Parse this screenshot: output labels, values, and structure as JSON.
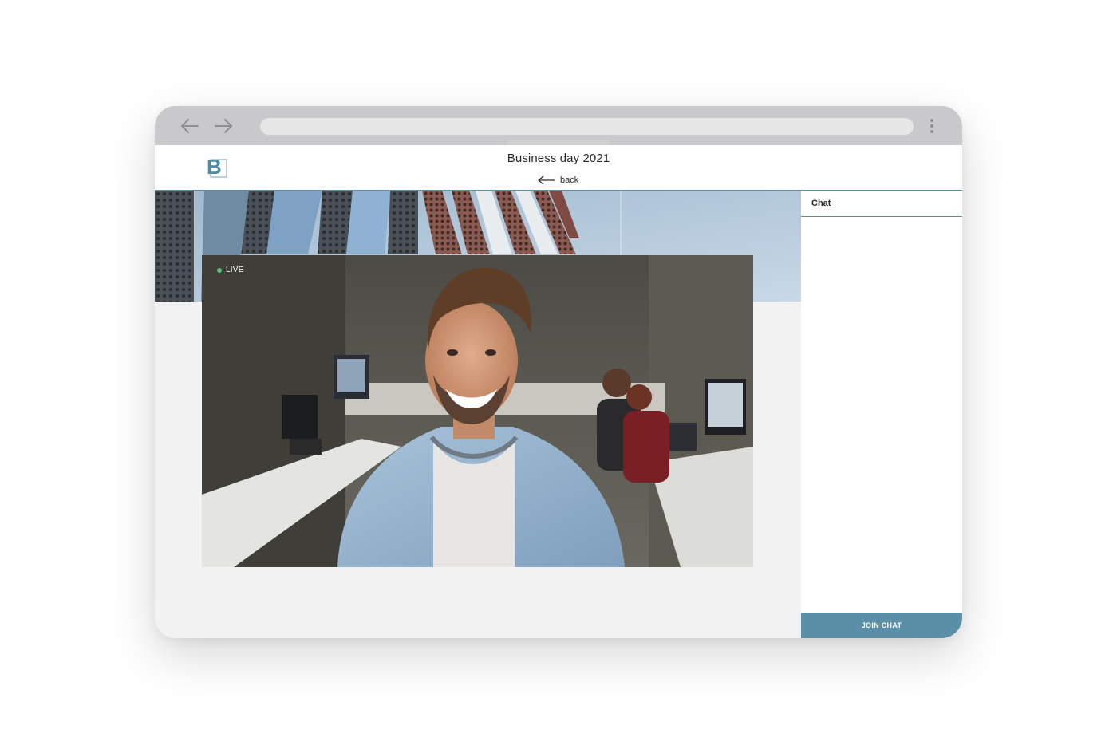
{
  "browser": {
    "nav": {
      "back_icon": "arrow-left-icon",
      "forward_icon": "arrow-right-icon",
      "menu_icon": "kebab-menu-icon"
    },
    "address_bar": {
      "value": "",
      "placeholder": ""
    }
  },
  "header": {
    "logo_letter": "B",
    "event_title": "Business day 2021",
    "back_label": "back"
  },
  "stream": {
    "status_label": "LIVE",
    "status_color": "#5fbf7a"
  },
  "chat": {
    "title": "Chat",
    "join_label": "JOIN CHAT"
  },
  "colors": {
    "accent": "#5b8fa8",
    "chrome": "#c9c8ca",
    "content_bg": "#f2f2f2"
  }
}
